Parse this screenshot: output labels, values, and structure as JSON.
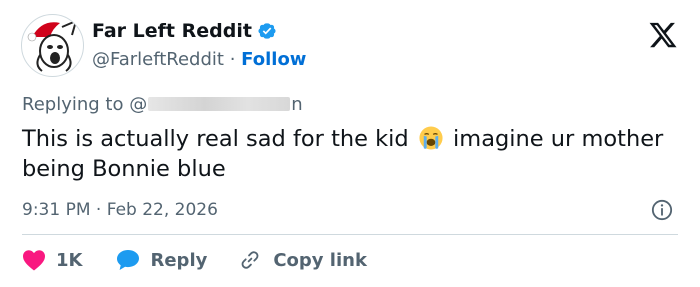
{
  "author": {
    "name": "Far Left Reddit",
    "handle": "@FarleftReddit",
    "separator": "·",
    "follow_label": "Follow"
  },
  "replying": {
    "prefix": "Replying to @",
    "suffix": "n"
  },
  "tweet": {
    "text_before_emoji": "This is actually real sad for the kid",
    "emoji": "loudly-crying-face",
    "text_after_emoji": "imagine ur mother being Bonnie blue"
  },
  "timestamp": {
    "time": "9:31 PM",
    "separator": "·",
    "date": "Feb 22, 2026"
  },
  "actions": {
    "likes_count": "1K",
    "reply_label": "Reply",
    "copy_link_label": "Copy link"
  },
  "colors": {
    "accent_blue": "#1d9bf0",
    "follow_blue": "#006fd6",
    "like_red": "#f91880",
    "text_primary": "#0f1419",
    "text_secondary": "#536471",
    "divider": "#cfd9de"
  },
  "icons": [
    "verified-badge-icon",
    "x-logo-icon",
    "loudly-crying-face-emoji",
    "info-icon",
    "heart-icon",
    "speech-bubble-icon",
    "link-icon"
  ]
}
